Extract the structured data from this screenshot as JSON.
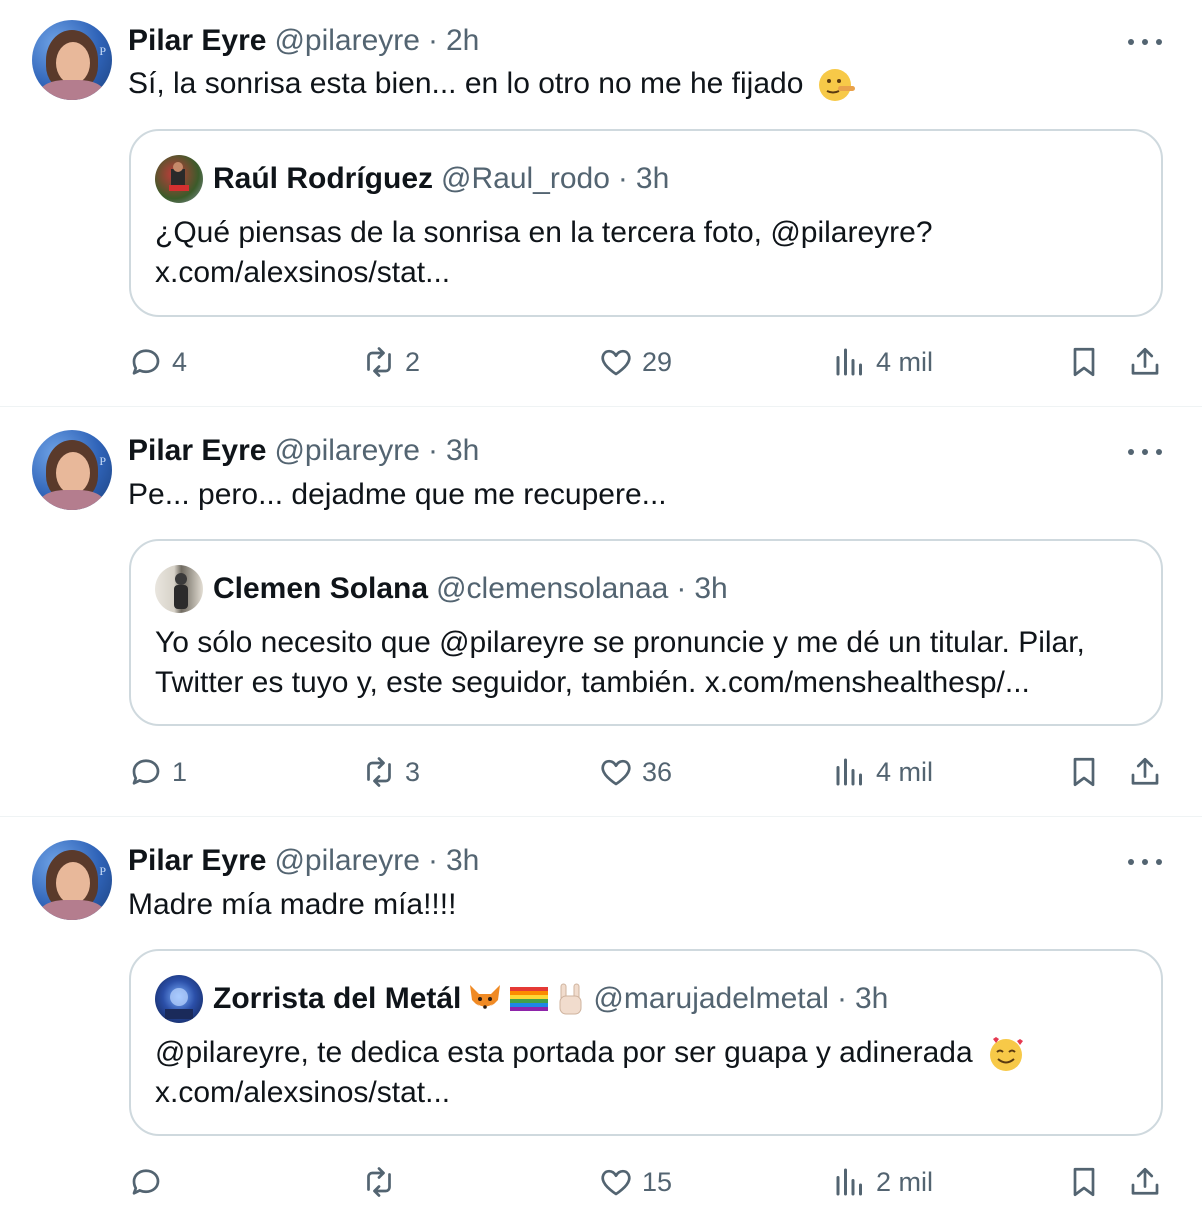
{
  "tweets": [
    {
      "author": {
        "name": "Pilar Eyre",
        "handle": "@pilareyre",
        "time": "2h",
        "avatar_letter": "P"
      },
      "text": "Sí, la sonrisa esta bien... en lo otro no me he fijado",
      "text_emoji": "lying-face-emoji",
      "quote": {
        "name": "Raúl Rodríguez",
        "handle": "@Raul_rodo",
        "time": "3h",
        "lines": [
          "¿Qué piensas de la sonrisa en la tercera foto, @pilareyre?",
          "x.com/alexsinos/stat..."
        ]
      },
      "actions": {
        "replies": "4",
        "reposts": "2",
        "likes": "29",
        "views": "4 mil"
      }
    },
    {
      "author": {
        "name": "Pilar Eyre",
        "handle": "@pilareyre",
        "time": "3h",
        "avatar_letter": "P"
      },
      "text": "Pe... pero... dejadme que me recupere...",
      "quote": {
        "name": "Clemen Solana",
        "handle": "@clemensolanaa",
        "time": "3h",
        "lines": [
          "Yo sólo necesito que @pilareyre se pronuncie y me dé un titular. Pilar,",
          "Twitter es tuyo y, este seguidor, también. x.com/menshealthesp/..."
        ]
      },
      "actions": {
        "replies": "1",
        "reposts": "3",
        "likes": "36",
        "views": "4 mil"
      }
    },
    {
      "author": {
        "name": "Pilar Eyre",
        "handle": "@pilareyre",
        "time": "3h",
        "avatar_letter": "P"
      },
      "text": "Madre mía madre mía!!!!",
      "quote": {
        "name": "Zorrista del Metál",
        "name_emojis": [
          "fox-emoji",
          "rainbow-flag-emoji",
          "rock-hand-emoji"
        ],
        "handle": "@marujadelmetal",
        "time": "3h",
        "lines": [
          "@pilareyre, te dedica esta portada por ser guapa y adinerada",
          "x.com/alexsinos/stat..."
        ],
        "line_emoji": "smiling-face-with-hearts-emoji"
      },
      "actions": {
        "replies": "",
        "reposts": "",
        "likes": "15",
        "views": "2 mil"
      }
    }
  ],
  "separator": "·",
  "colors": {
    "text": "#0f1419",
    "secondary": "#536471",
    "border": "#cfd9de",
    "divider": "#eff3f4"
  }
}
